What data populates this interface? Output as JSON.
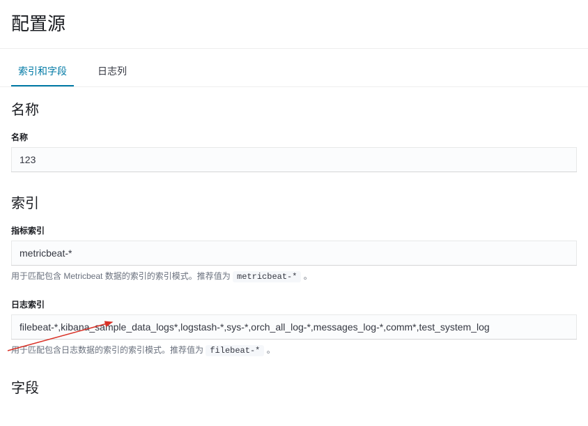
{
  "header": {
    "title": "配置源"
  },
  "tabs": [
    {
      "label": "索引和字段",
      "active": true
    },
    {
      "label": "日志列",
      "active": false
    }
  ],
  "sections": {
    "name": {
      "heading": "名称",
      "field_label": "名称",
      "value": "123"
    },
    "index": {
      "heading": "索引",
      "metric": {
        "label": "指标索引",
        "value": "metricbeat-*",
        "help_prefix": "用于匹配包含 Metricbeat 数据的索引的索引模式。推荐值为 ",
        "help_code": "metricbeat-*",
        "help_suffix": " 。"
      },
      "log": {
        "label": "日志索引",
        "value": "filebeat-*,kibana_sample_data_logs*,logstash-*,sys-*,orch_all_log-*,messages_log-*,comm*,test_system_log",
        "help_prefix": "用于匹配包含日志数据的索引的索引模式。推荐值为 ",
        "help_code": "filebeat-*",
        "help_suffix": " 。"
      }
    },
    "fields": {
      "heading": "字段"
    }
  }
}
